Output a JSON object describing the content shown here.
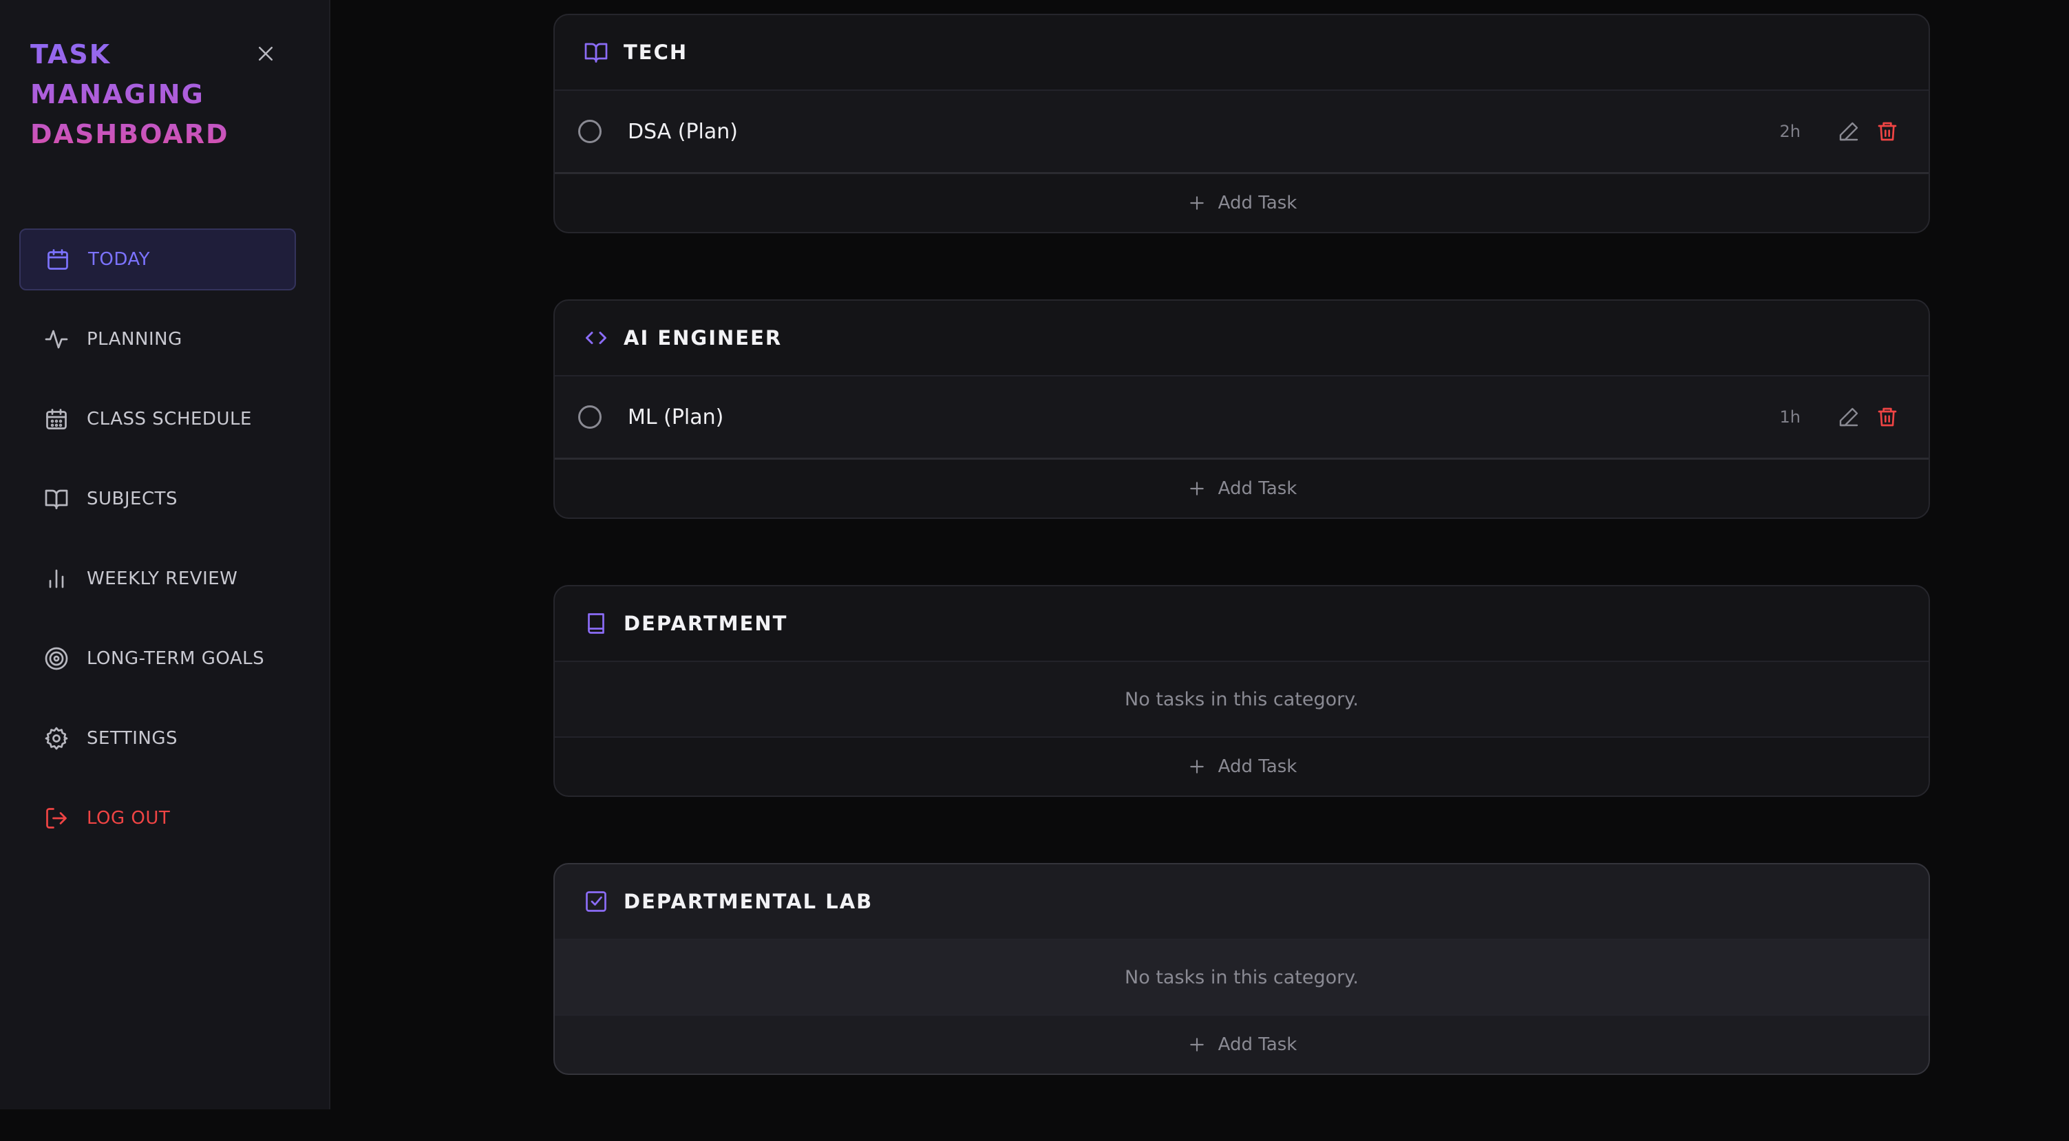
{
  "sidebar": {
    "brand_lines": [
      "TASK",
      "MANAGING",
      "DASHBOARD"
    ],
    "close_icon": "close-icon",
    "items": [
      {
        "label": "TODAY",
        "icon": "calendar-icon",
        "active": true
      },
      {
        "label": "PLANNING",
        "icon": "activity-icon"
      },
      {
        "label": "CLASS SCHEDULE",
        "icon": "calendar-grid-icon"
      },
      {
        "label": "SUBJECTS",
        "icon": "book-open-icon"
      },
      {
        "label": "WEEKLY REVIEW",
        "icon": "bar-chart-icon"
      },
      {
        "label": "LONG-TERM GOALS",
        "icon": "target-icon"
      },
      {
        "label": "SETTINGS",
        "icon": "gear-icon"
      }
    ],
    "logout_label": "LOG OUT",
    "colors": {
      "active": "#7c73ff",
      "logout": "#ef4444"
    }
  },
  "main": {
    "add_task_label": "Add Task",
    "empty_text": "No tasks in this category.",
    "categories": [
      {
        "title": "TECH",
        "icon": "book-open-icon",
        "tasks": [
          {
            "title": "DSA (Plan)",
            "duration": "2h"
          }
        ]
      },
      {
        "title": "AI ENGINEER",
        "icon": "code-icon",
        "tasks": [
          {
            "title": "ML (Plan)",
            "duration": "1h"
          }
        ]
      },
      {
        "title": "DEPARTMENT",
        "icon": "book-icon",
        "tasks": []
      },
      {
        "title": "DEPARTMENTAL LAB",
        "icon": "check-square-icon",
        "tasks": []
      }
    ],
    "colors": {
      "accent": "#8b6cf6",
      "delete": "#ef4444"
    }
  }
}
